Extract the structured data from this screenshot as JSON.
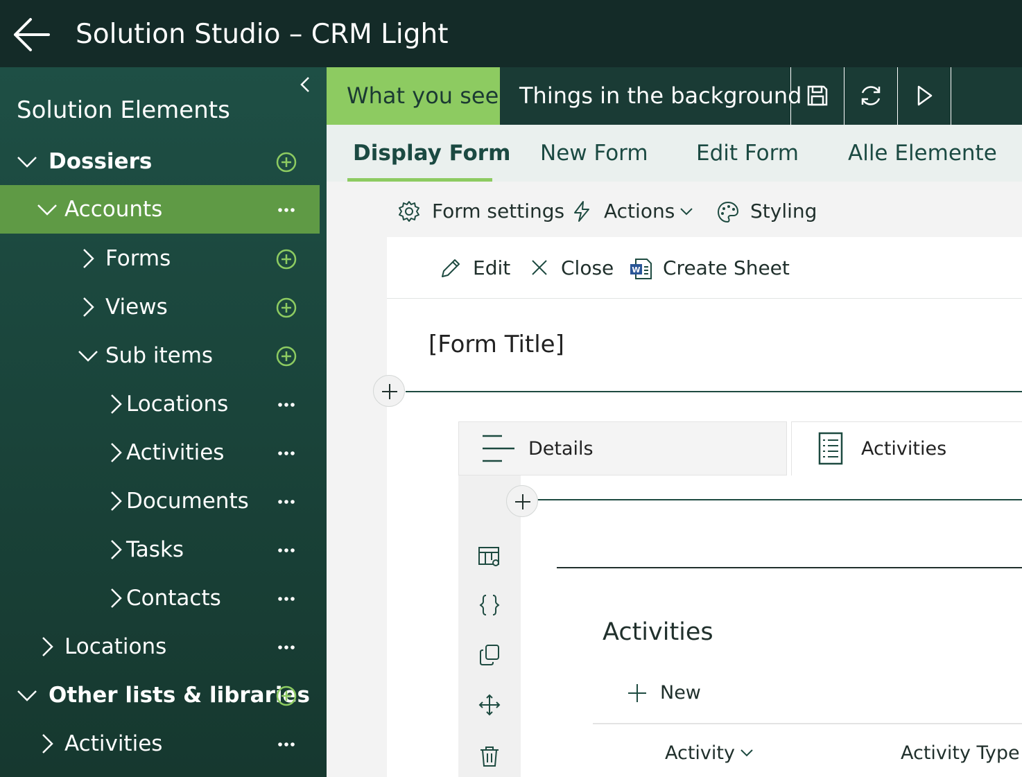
{
  "app": {
    "title": "Solution Studio – CRM Light"
  },
  "sidebar": {
    "title": "Solution Elements",
    "rows": [
      {
        "label": "Dossiers"
      },
      {
        "label": "Accounts"
      },
      {
        "label": "Forms"
      },
      {
        "label": "Views"
      },
      {
        "label": "Sub items"
      },
      {
        "label": "Locations"
      },
      {
        "label": "Activities"
      },
      {
        "label": "Documents"
      },
      {
        "label": "Tasks"
      },
      {
        "label": "Contacts"
      },
      {
        "label": "Locations"
      },
      {
        "label": "Other lists & libraries"
      },
      {
        "label": "Activities"
      }
    ]
  },
  "mode_tabs": {
    "what_you_see": "What you see",
    "background": "Things in the background"
  },
  "form_tabs": {
    "display": "Display Form",
    "new": "New Form",
    "edit": "Edit Form",
    "all": "Alle Elemente"
  },
  "settings_bar": {
    "form_settings": "Form settings",
    "actions": "Actions",
    "styling": "Styling"
  },
  "commands": {
    "edit": "Edit",
    "close": "Close",
    "create_sheet": "Create Sheet"
  },
  "form": {
    "title": "[Form Title]",
    "tabs": {
      "details": "Details",
      "activities": "Activities"
    },
    "section": {
      "title": "Activities",
      "new_label": "New",
      "columns": {
        "activity": "Activity",
        "activity_type": "Activity Type"
      }
    }
  },
  "colors": {
    "topbar": "#142b28",
    "sidebar": "#1e4f45",
    "selected": "#5f9a45",
    "accent": "#8dcb61",
    "mode_bar": "#1a3b35"
  }
}
